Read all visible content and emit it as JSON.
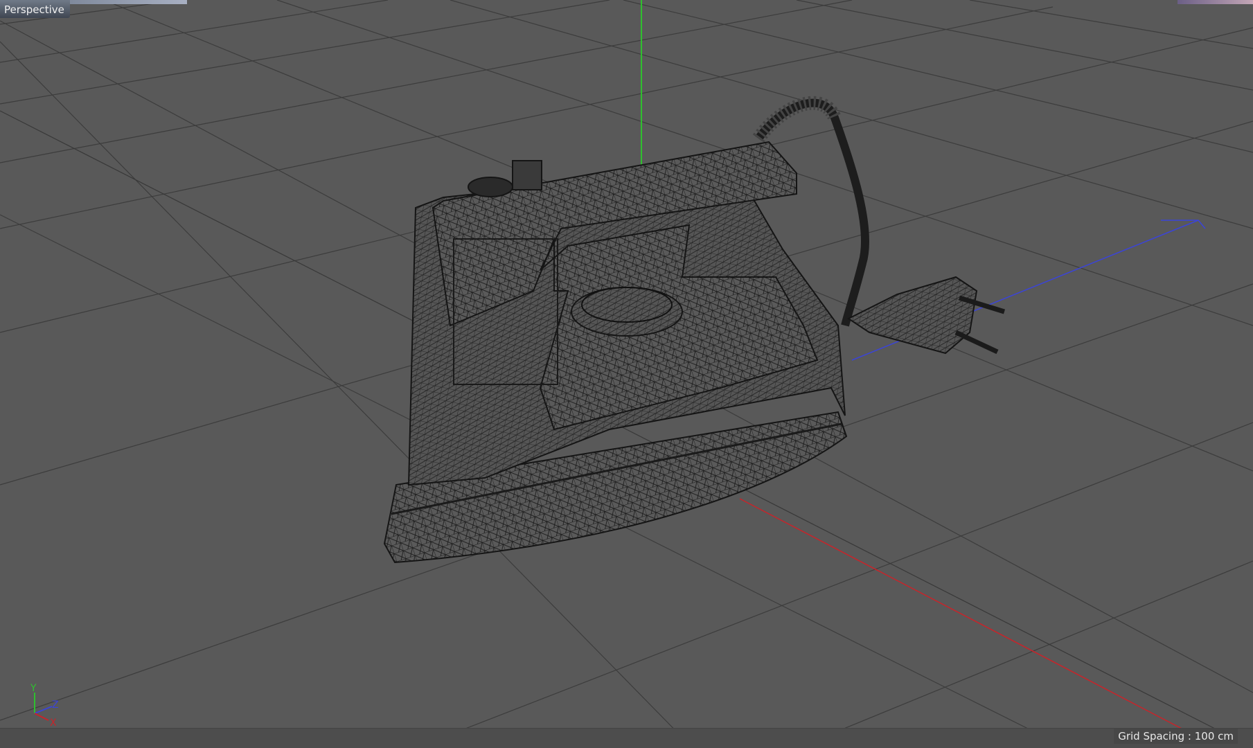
{
  "viewport": {
    "name": "Perspective",
    "status": {
      "grid_spacing_label": "Grid Spacing",
      "grid_spacing_value": "100 cm"
    }
  },
  "axis_gizmo": {
    "y": "Y",
    "z": "Z",
    "x": "X"
  },
  "object": {
    "kind": "clothes iron",
    "display_mode": "wireframe"
  },
  "colors": {
    "background": "#595959",
    "grid_line": "#3a3a3a",
    "wire": "#1a1a1a",
    "axis_x": "#c8242a",
    "axis_y": "#2fbf2f",
    "axis_z": "#3b44d8"
  }
}
